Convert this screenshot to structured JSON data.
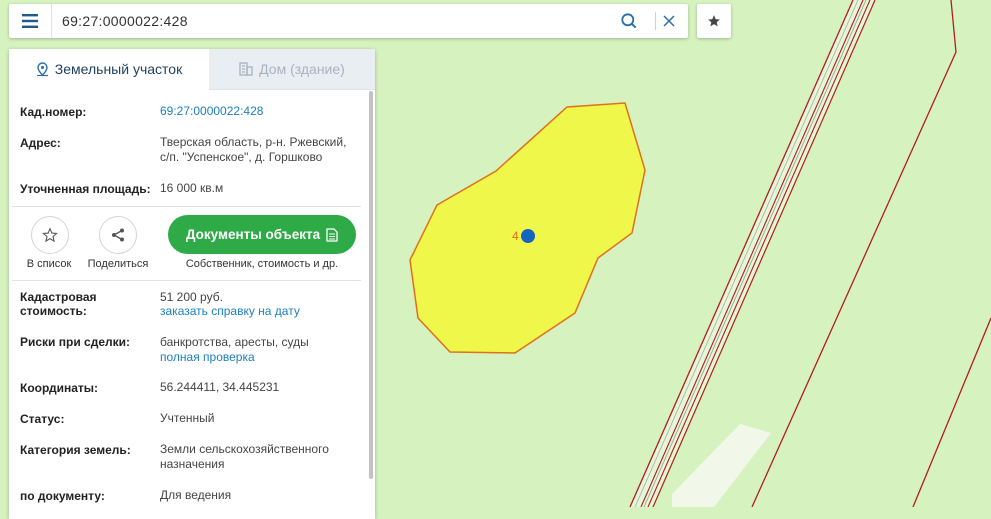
{
  "search": {
    "query": "69:27:0000022:428"
  },
  "tabs": [
    {
      "label": "Земельный участок"
    },
    {
      "label": "Дом (здание)"
    }
  ],
  "info": {
    "cad_label": "Кад.номер:",
    "cad_value": "69:27:0000022:428",
    "address_label": "Адрес:",
    "address_line1": "Тверская область, р-н. Ржевский,",
    "address_line2": "с/п. \"Успенское\", д. Горшково",
    "area_label": "Уточненная площадь:",
    "area_value": "16 000 кв.м"
  },
  "actions": {
    "add_list": "В список",
    "share": "Поделиться",
    "docs_button": "Документы объекта",
    "docs_caption": "Собственник, стоимость и др."
  },
  "details": {
    "cost_label_1": "Кадастровая",
    "cost_label_2": "стоимость:",
    "cost_value": "51 200 руб.",
    "cost_link": "заказать справку на дату",
    "risks_label": "Риски при сделки:",
    "risks_value": "банкротства, аресты, суды",
    "risks_link": "полная проверка",
    "coords_label": "Координаты:",
    "coords_value": "56.244411, 34.445231",
    "status_label": "Статус:",
    "status_value": "Учтенный",
    "category_label": "Категория земель:",
    "category_line1": "Земли сельскохозяйственного",
    "category_line2": "назначения",
    "doc_label": "по документу:",
    "doc_value": "Для ведения"
  },
  "map": {
    "parcel_label": "4",
    "colors": {
      "background": "#d6f2bf",
      "parcel_fill": "#eef74a",
      "parcel_border": "#e0701a",
      "marker": "#1565c0",
      "boundary": "#b51c1c",
      "accent": "#2eaa47",
      "link": "#1d80c0"
    }
  }
}
